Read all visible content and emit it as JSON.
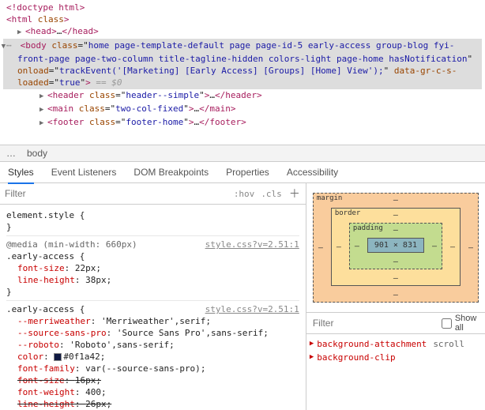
{
  "dom": {
    "doctype": "<!doctype html>",
    "html_open": "html",
    "html_class_attr": "class",
    "head": "head",
    "ellipsis": "…",
    "body_tag": "body",
    "body_class_attr": "class",
    "body_class_val": "home page-template-default page page-id-5 early-access group-blog fyi-front-page page-two-column title-tagline-hidden colors-light page-home hasNotification",
    "body_onload_attr": "onload",
    "body_onload_val": "trackEvent('[Marketing] [Early Access] [Groups] [Home] View');",
    "body_data_attr": "data-gr-c-s-loaded",
    "body_data_val": "true",
    "eq0": " == $0",
    "header_tag": "header",
    "header_class": "header--simple",
    "main_tag": "main",
    "main_class": "two-col-fixed",
    "footer_tag": "footer",
    "footer_class": "footer-home"
  },
  "breadcrumb": {
    "ell": "…",
    "item": "body"
  },
  "tabs": {
    "t0": "Styles",
    "t1": "Event Listeners",
    "t2": "DOM Breakpoints",
    "t3": "Properties",
    "t4": "Accessibility"
  },
  "filter": {
    "ph": "Filter",
    "hov": ":hov",
    "cls": ".cls"
  },
  "rules": {
    "r0_sel": "element.style",
    "media": "@media (min-width: 660px)",
    "r1_sel": ".early-access",
    "r1_src": "style.css?v=2.51:1",
    "r1_p0n": "font-size",
    "r1_p0v": "22px",
    "r1_p1n": "line-height",
    "r1_p1v": "38px",
    "r2_sel": ".early-access",
    "r2_src": "style.css?v=2.51:1",
    "r2_p0n": "--merriweather",
    "r2_p0v": "'Merriweather',serif",
    "r2_p1n": "--source-sans-pro",
    "r2_p1v": "'Source Sans Pro',sans-serif",
    "r2_p2n": "--roboto",
    "r2_p2v": "'Roboto',sans-serif",
    "r2_p3n": "color",
    "r2_p3v": "#0f1a42",
    "r2_p4n": "font-family",
    "r2_p4v": "var(--source-sans-pro)",
    "r2_p5n": "font-size",
    "r2_p5v": "16px",
    "r2_p6n": "font-weight",
    "r2_p6v": "400",
    "r2_p7n": "line-height",
    "r2_p7v": "26px"
  },
  "boxmodel": {
    "margin": "margin",
    "border": "border",
    "padding": "padding",
    "content": "901 × 831",
    "dash": "–"
  },
  "computed": {
    "filter_ph": "Filter",
    "showall": "Show all",
    "p0n": "background-attachment",
    "p0v": "scroll",
    "p1n": "background-clip"
  }
}
